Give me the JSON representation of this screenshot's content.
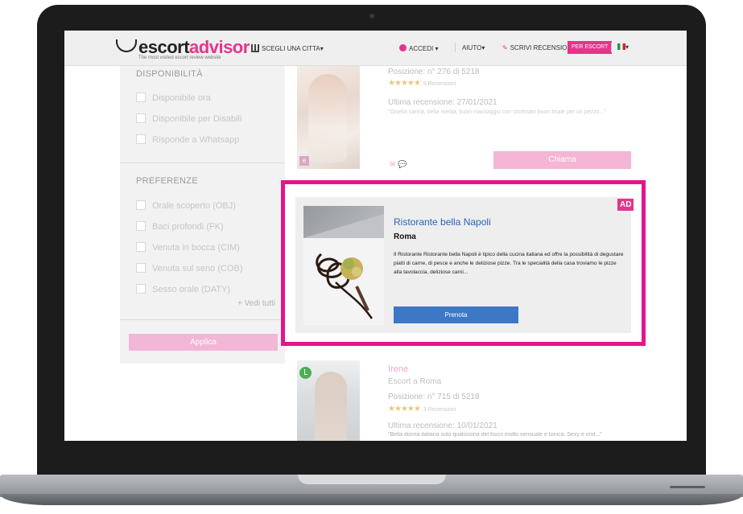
{
  "header": {
    "logo_main": "escort",
    "logo_accent": "advisor",
    "tagline": "The most visited escort review website",
    "city_select": "SCEGLI UNA CITTA",
    "accedi": "ACCEDI",
    "aiuto": "AIUTO",
    "scrivi": "SCRIVI RECENSIONE",
    "per_escort": "PER ESCORT",
    "caret": "▾"
  },
  "sidebar": {
    "disponibilita_title": "DISPONIBILITÀ",
    "disponibilita": [
      "Disponibile ora",
      "Disponibile per Disabili",
      "Risponde a Whatsapp"
    ],
    "preferenze_title": "PREFERENZE",
    "preferenze": [
      "Orale scoperto (OBJ)",
      "Baci profondi (FK)",
      "Venuta in bocca (CIM)",
      "Venuta sul seno (COB)",
      "Sesso orale (DATY)"
    ],
    "vedi_tutti": "+ Vedi tutti",
    "applica": "Applica"
  },
  "card1": {
    "posizione": "Posizione: n° 276 di 5218",
    "stars": "★★★★★",
    "recensioni": "5 Recensioni",
    "ultima": "Ultima recensione: 27/01/2021",
    "quote": "\"Gisella carina, bella media, buon massaggio con strofinato buon finale per un pezzo...\"",
    "icons": "✉ 💬",
    "badge": "e",
    "chiama": "Chiama"
  },
  "ad": {
    "tag": "AD",
    "title": "Ristorante bella Napoli",
    "city": "Roma",
    "description": "Il Ristorante Ristorante bella Napoli è tipico della cucina italiana ed offre la possibilità di degustare piatti di carne, di pesce e anche le deliziose pizze. Tra le specialità della casa troviamo le pizze alla tavolaccia, deliziose carni...",
    "button": "Prenota"
  },
  "card2": {
    "name": "Irene",
    "subtitle": "Escort a Roma",
    "posizione": "Posizione: n° 715 di 5218",
    "stars": "★★★★★",
    "recensioni": "3 Recensioni",
    "ultima": "Ultima recensione: 10/01/2021",
    "quote": "\"Bella donna italiana solo qualcosina del fisico molto sensuale e tonica. Sexy e crot...\""
  },
  "colors": {
    "brand_pink": "#e6348a",
    "ad_frame": "#e8128a",
    "ad_title_blue": "#2a63b3",
    "button_blue": "#3d78c7"
  }
}
